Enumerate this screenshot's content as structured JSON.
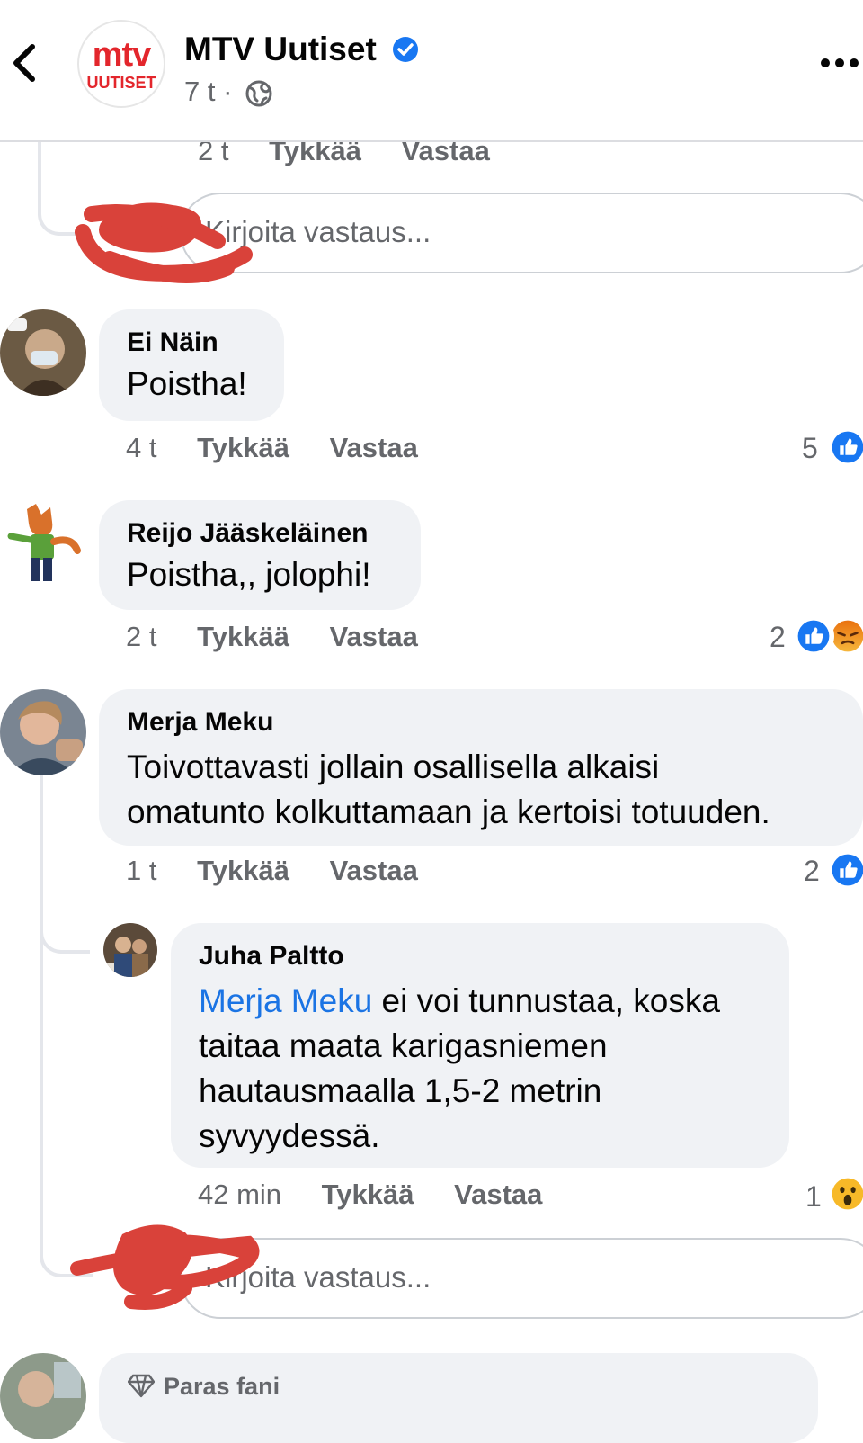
{
  "header": {
    "page_name": "MTV Uutiset",
    "logo_top": "mtv",
    "logo_bottom": "UUTISET",
    "time": "7 t ·"
  },
  "top_meta": {
    "time": "2 t",
    "like": "Tykkää",
    "reply": "Vastaa"
  },
  "reply_placeholder": "Kirjoita vastaus...",
  "comments": [
    {
      "author": "Ei Näin",
      "text": "Poistha!",
      "time": "4 t",
      "like": "Tykkää",
      "reply": "Vastaa",
      "reactions": "5"
    },
    {
      "author": "Reijo Jääskeläinen",
      "text": "Poistha,, jolophi!",
      "time": "2 t",
      "like": "Tykkää",
      "reply": "Vastaa",
      "reactions": "2"
    },
    {
      "author": "Merja Meku",
      "text_line1": "Toivottavasti jollain osallisella alkaisi",
      "text_line2": "omatunto kolkuttamaan ja kertoisi totuuden.",
      "time": "1 t",
      "like": "Tykkää",
      "reply": "Vastaa",
      "reactions": "2"
    }
  ],
  "reply": {
    "author": "Juha Paltto",
    "mention": "Merja Meku",
    "line1": " ei voi tunnustaa, koska",
    "line2": "taitaa maata karigasniemen",
    "line3": "hautausmaalla 1,5-2 metrin",
    "line4": "syvyydessä.",
    "time": "42 min",
    "like": "Tykkää",
    "reply": "Vastaa",
    "reactions": "1"
  },
  "bottom": {
    "badge": "Paras fani"
  },
  "colors": {
    "like_blue": "#1877f2",
    "angry": "#e9710f",
    "wow": "#f7b928",
    "mention": "#1b74e4",
    "brand_red": "#e3262c"
  }
}
